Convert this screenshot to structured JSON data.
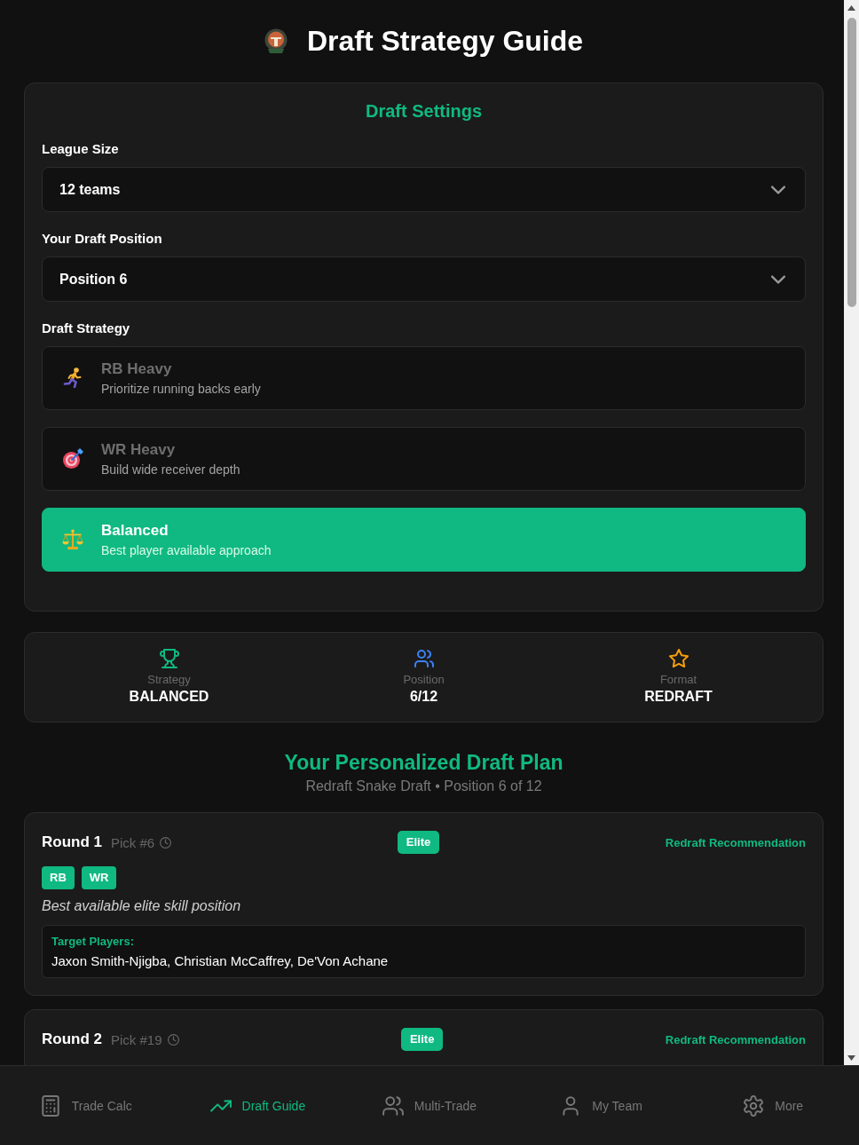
{
  "header": {
    "title": "Draft Strategy Guide"
  },
  "settings": {
    "title": "Draft Settings",
    "fields": [
      {
        "label": "League Size",
        "value": "12 teams"
      },
      {
        "label": "Your Draft Position",
        "value": "Position 6"
      }
    ],
    "strategy_label": "Draft Strategy",
    "strategies": [
      {
        "kind": "runner",
        "title": "RB Heavy",
        "description": "Prioritize running backs early",
        "selected": false
      },
      {
        "kind": "target",
        "title": "WR Heavy",
        "description": "Build wide receiver depth",
        "selected": false
      },
      {
        "kind": "scales",
        "title": "Balanced",
        "description": "Best player available approach",
        "selected": true
      }
    ]
  },
  "summary": [
    {
      "kind": "trophy",
      "label": "Strategy",
      "value": "BALANCED",
      "color": "#10b981"
    },
    {
      "kind": "users",
      "label": "Position",
      "value": "6/12",
      "color": "#3b82f6"
    },
    {
      "kind": "star",
      "label": "Format",
      "value": "REDRAFT",
      "color": "#f59e0b"
    }
  ],
  "plan": {
    "title": "Your Personalized Draft Plan",
    "subtitle": "Redraft Snake Draft • Position 6 of 12",
    "rounds": [
      {
        "round": "Round 1",
        "pick": "Pick #6",
        "tier": "Elite",
        "recommendation": "Redraft Recommendation",
        "positions": [
          "RB",
          "WR"
        ],
        "note": "Best available elite skill position",
        "targets_label": "Target Players:",
        "targets": "Jaxon Smith-Njigba, Christian McCaffrey, De'Von Achane"
      },
      {
        "round": "Round 2",
        "pick": "Pick #19",
        "tier": "Elite",
        "recommendation": "Redraft Recommendation"
      }
    ]
  },
  "nav": [
    {
      "kind": "calculator",
      "label": "Trade Calc",
      "selected": false
    },
    {
      "kind": "trending",
      "label": "Draft Guide",
      "selected": true
    },
    {
      "kind": "users",
      "label": "Multi-Trade",
      "selected": false
    },
    {
      "kind": "user",
      "label": "My Team",
      "selected": false
    },
    {
      "kind": "gear",
      "label": "More",
      "selected": false
    }
  ]
}
